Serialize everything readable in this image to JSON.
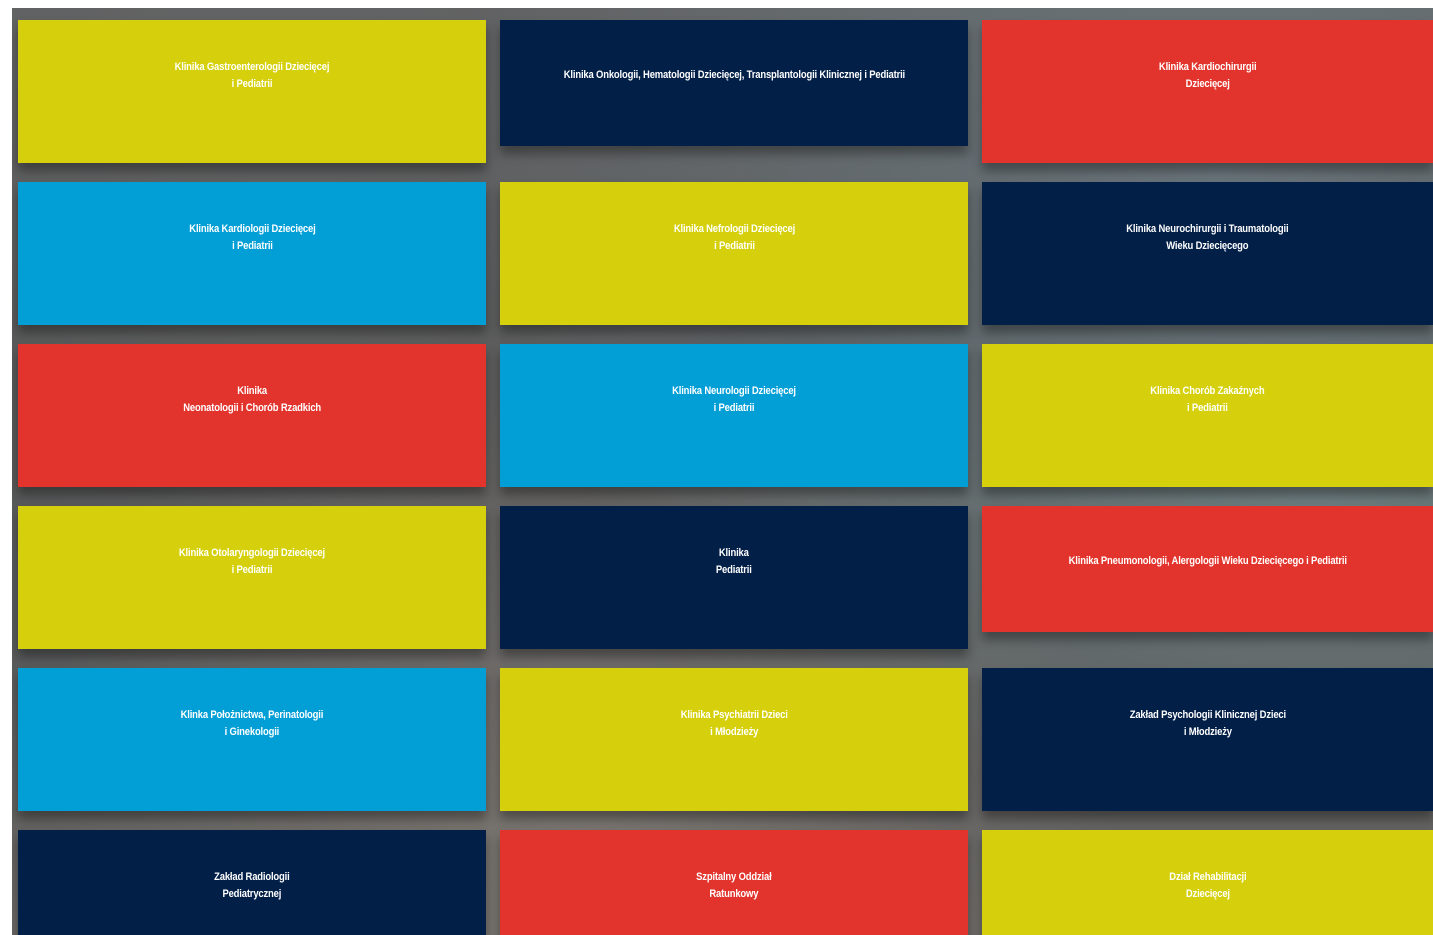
{
  "colors": {
    "yellow": "#d5d00b",
    "navy": "#021f48",
    "red": "#e2342c",
    "blue": "#029fd7"
  },
  "tiles": [
    {
      "label": "Klinika Gastroenterologii Dziecięcej\ni Pediatrii",
      "color": "yellow"
    },
    {
      "label": "Klinika Onkologii, Hematologii Dziecięcej, Transplantologii Klinicznej i Pediatrii",
      "color": "navy"
    },
    {
      "label": "Klinika Kardiochirurgii\nDziecięcej",
      "color": "red"
    },
    {
      "label": "Klinika Kardiologii Dziecięcej\ni Pediatrii",
      "color": "blue"
    },
    {
      "label": "Klinika Nefrologii Dziecięcej\ni Pediatrii",
      "color": "yellow"
    },
    {
      "label": "Klinika Neurochirurgii i Traumatologii\nWieku Dziecięcego",
      "color": "navy"
    },
    {
      "label": "Klinika\nNeonatologii i Chorób Rzadkich",
      "color": "red"
    },
    {
      "label": "Klinika Neurologii Dziecięcej\ni Pediatrii",
      "color": "blue"
    },
    {
      "label": "Klinika Chorób Zakaźnych\ni Pediatrii",
      "color": "yellow"
    },
    {
      "label": "Klinika Otolaryngologii Dziecięcej\ni Pediatrii",
      "color": "yellow"
    },
    {
      "label": "Klinika\nPediatrii",
      "color": "navy"
    },
    {
      "label": "Klinika Pneumonologii, Alergologii Wieku Dziecięcego i Pediatrii",
      "color": "red"
    },
    {
      "label": "Klinka Położnictwa, Perinatologii\ni Ginekologii",
      "color": "blue"
    },
    {
      "label": "Klinika Psychiatrii Dzieci\ni Młodzieży",
      "color": "yellow"
    },
    {
      "label": "Zakład Psychologii Klinicznej Dzieci\ni Młodzieży",
      "color": "navy"
    },
    {
      "label": "Zakład Radiologii\nPediatrycznej",
      "color": "navy"
    },
    {
      "label": "Szpitalny Oddział\nRatunkowy",
      "color": "red"
    },
    {
      "label": "Dział Rehabilitacji\nDziecięcej",
      "color": "yellow"
    }
  ]
}
